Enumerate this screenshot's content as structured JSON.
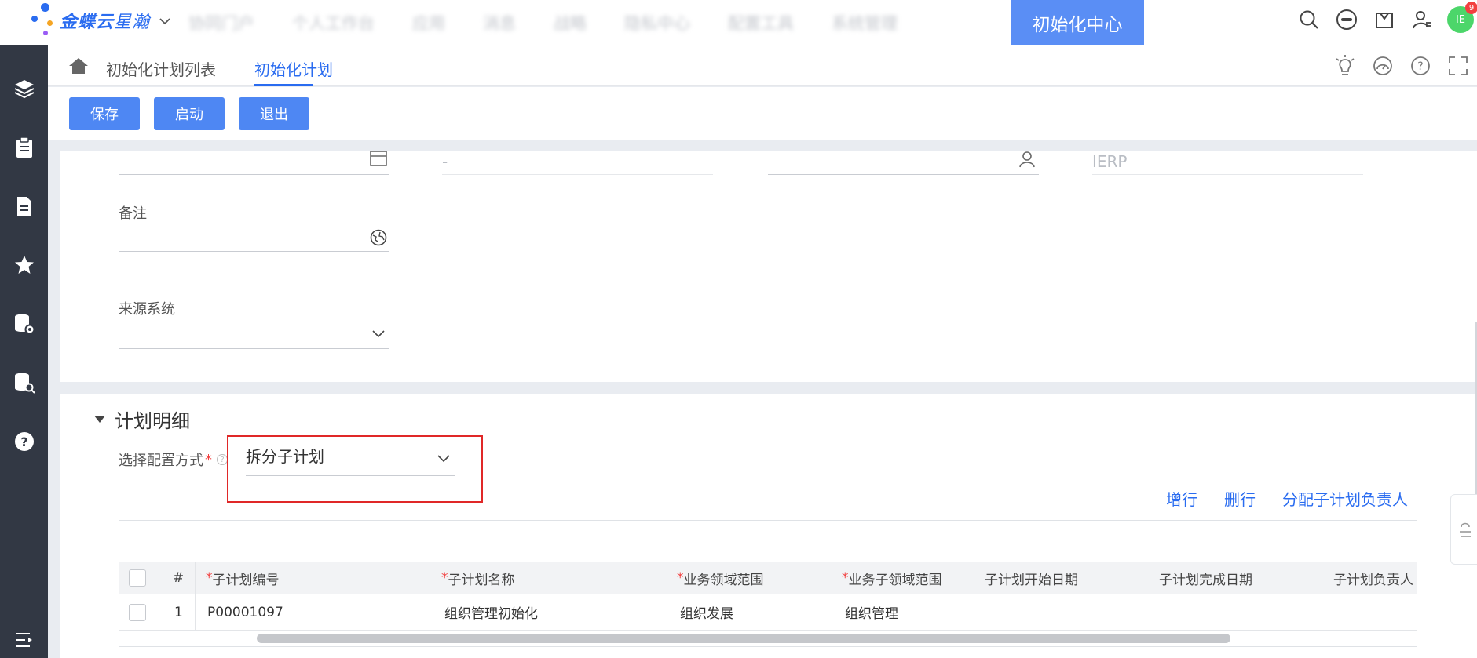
{
  "header": {
    "logo_brand": "金蝶云",
    "logo_product": "星瀚",
    "nav": [
      "协同门户",
      "个人工作台",
      "应用",
      "消息",
      "战略",
      "隐私中心",
      "配置工具",
      "系统管理"
    ],
    "active_app": "初始化中心",
    "avatar_initials": "IE",
    "avatar_badge": "9"
  },
  "breadcrumbs": {
    "items": [
      "初始化计划列表",
      "初始化计划"
    ],
    "active_index": 1
  },
  "toolbar": {
    "save_label": "保存",
    "start_label": "启动",
    "exit_label": "退出"
  },
  "form": {
    "row1_value2": "-",
    "row1_value4": "IERP",
    "remark_label": "备注",
    "source_system_label": "来源系统"
  },
  "detail": {
    "title": "计划明细",
    "config_label": "选择配置方式",
    "config_value": "拆分子计划",
    "links": [
      "增行",
      "删行",
      "分配子计划负责人"
    ],
    "columns": [
      {
        "label": "#",
        "required": false
      },
      {
        "label": "子计划编号",
        "required": true
      },
      {
        "label": "子计划名称",
        "required": true
      },
      {
        "label": "业务领域范围",
        "required": true
      },
      {
        "label": "业务子领域范围",
        "required": true
      },
      {
        "label": "子计划开始日期",
        "required": false
      },
      {
        "label": "子计划完成日期",
        "required": false
      },
      {
        "label": "子计划负责人",
        "required": false
      }
    ],
    "rows": [
      {
        "index": "1",
        "code": "P00001097",
        "name": "组织管理初始化",
        "domain": "组织发展",
        "subdomain": "组织管理"
      }
    ]
  },
  "colors": {
    "accent": "#2a6cf0",
    "button": "#4e87f3",
    "active_app_bg": "#5a8ef5",
    "sidebar_bg": "#323844",
    "highlight_border": "#e02828",
    "required": "#f24040"
  }
}
